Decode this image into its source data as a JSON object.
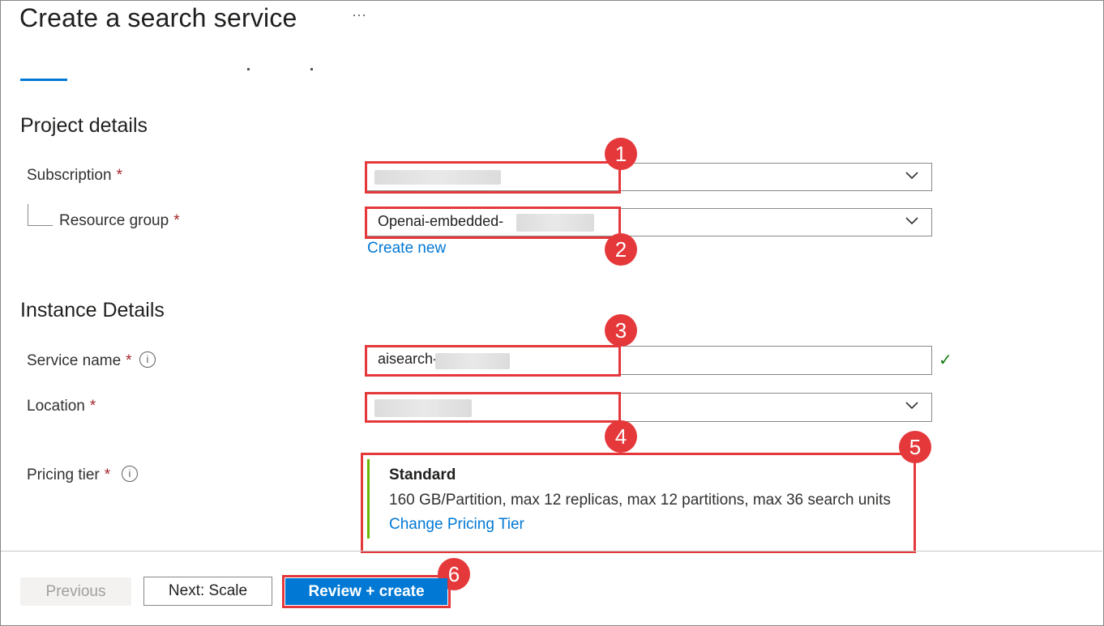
{
  "header": {
    "title": "Create a search service",
    "more": "···"
  },
  "project_details": {
    "heading": "Project details",
    "subscription": {
      "label": "Subscription",
      "required": "*",
      "value": ""
    },
    "resource_group": {
      "label": "Resource group",
      "required": "*",
      "value": "Openai-embedded-",
      "create_new": "Create new"
    }
  },
  "instance_details": {
    "heading": "Instance Details",
    "service_name": {
      "label": "Service name",
      "required": "*",
      "value": "aisearch-",
      "info": "i",
      "valid": "✓"
    },
    "location": {
      "label": "Location",
      "required": "*",
      "value": ""
    },
    "pricing_tier": {
      "label": "Pricing tier",
      "required": "*",
      "info": "i",
      "name": "Standard",
      "description": "160 GB/Partition, max 12 replicas, max 12 partitions, max 36 search units",
      "change_link": "Change Pricing Tier"
    }
  },
  "callouts": [
    "1",
    "2",
    "3",
    "4",
    "5",
    "6"
  ],
  "footer": {
    "previous": "Previous",
    "next": "Next: Scale",
    "review": "Review + create"
  },
  "colors": {
    "accent": "#0078d4",
    "annotation": "#e5383b",
    "tier_bar": "#6bb700",
    "required": "#a4262c",
    "valid": "#107c10"
  }
}
